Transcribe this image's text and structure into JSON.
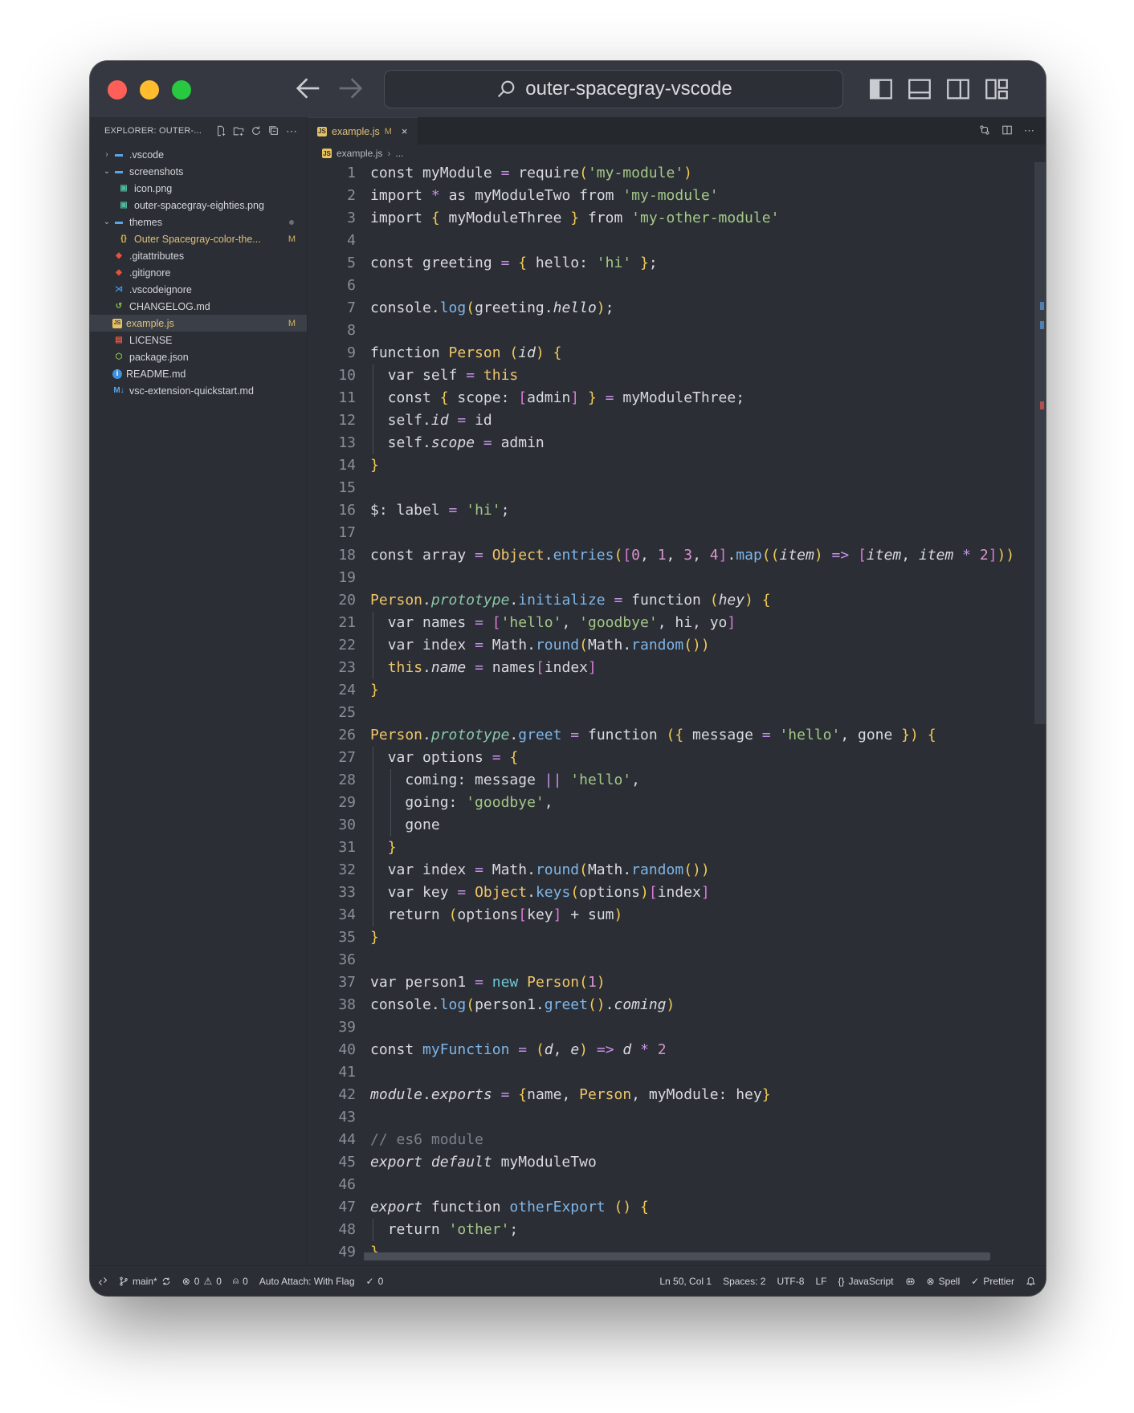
{
  "window": {
    "search_text": "outer-spacegray-vscode"
  },
  "explorer": {
    "title": "EXPLORER: OUTER-...",
    "items": [
      {
        "label": ".vscode",
        "kind": "folder",
        "open": false,
        "depth": 0
      },
      {
        "label": "screenshots",
        "kind": "folder",
        "open": true,
        "depth": 0
      },
      {
        "label": "icon.png",
        "kind": "image",
        "depth": 1
      },
      {
        "label": "outer-spacegray-eighties.png",
        "kind": "image",
        "depth": 1
      },
      {
        "label": "themes",
        "kind": "folder",
        "open": true,
        "depth": 0,
        "dot": true
      },
      {
        "label": "Outer Spacegray-color-the...",
        "kind": "json",
        "depth": 1,
        "badge": "M"
      },
      {
        "label": ".gitattributes",
        "kind": "git",
        "depth": 0
      },
      {
        "label": ".gitignore",
        "kind": "git",
        "depth": 0
      },
      {
        "label": ".vscodeignore",
        "kind": "vscode",
        "depth": 0
      },
      {
        "label": "CHANGELOG.md",
        "kind": "changelog",
        "depth": 0
      },
      {
        "label": "example.js",
        "kind": "js",
        "depth": 0,
        "badge": "M",
        "active": true
      },
      {
        "label": "LICENSE",
        "kind": "license",
        "depth": 0
      },
      {
        "label": "package.json",
        "kind": "package",
        "depth": 0
      },
      {
        "label": "README.md",
        "kind": "info",
        "depth": 0
      },
      {
        "label": "vsc-extension-quickstart.md",
        "kind": "md",
        "depth": 0
      }
    ]
  },
  "tab": {
    "label": "example.js",
    "badge": "M",
    "close": "×"
  },
  "breadcrumb": {
    "file": "example.js",
    "rest": "..."
  },
  "code_lines": [
    "const myModule = require('my-module')",
    "import * as myModuleTwo from 'my-module'",
    "import { myModuleThree } from 'my-other-module'",
    "",
    "const greeting = { hello: 'hi' };",
    "",
    "console.log(greeting.hello);",
    "",
    "function Person (id) {",
    "  var self = this",
    "  const { scope: [admin] } = myModuleThree;",
    "  self.id = id",
    "  self.scope = admin",
    "}",
    "",
    "$: label = 'hi';",
    "",
    "const array = Object.entries([0, 1, 3, 4].map((item) => [item, item * 2]))",
    "",
    "Person.prototype.initialize = function (hey) {",
    "  var names = ['hello', 'goodbye', hi, yo]",
    "  var index = Math.round(Math.random())",
    "  this.name = names[index]",
    "}",
    "",
    "Person.prototype.greet = function ({ message = 'hello', gone }) {",
    "  var options = {",
    "    coming: message || 'hello',",
    "    going: 'goodbye',",
    "    gone",
    "  }",
    "  var index = Math.round(Math.random())",
    "  var key = Object.keys(options)[index]",
    "  return (options[key] + sum)",
    "}",
    "",
    "var person1 = new Person(1)",
    "console.log(person1.greet().coming)",
    "",
    "const myFunction = (d, e) => d * 2",
    "",
    "module.exports = {name, Person, myModule: hey}",
    "",
    "// es6 module",
    "export default myModuleTwo",
    "",
    "export function otherExport () {",
    "  return 'other';",
    "}",
    ""
  ],
  "status": {
    "branch": "main*",
    "errors": "0",
    "warnings": "0",
    "ports": "0",
    "auto_attach": "Auto Attach: With Flag",
    "checks": "0",
    "position": "Ln 50, Col 1",
    "spaces": "Spaces: 2",
    "encoding": "UTF-8",
    "eol": "LF",
    "language": "JavaScript",
    "spell": "Spell",
    "prettier": "Prettier"
  }
}
